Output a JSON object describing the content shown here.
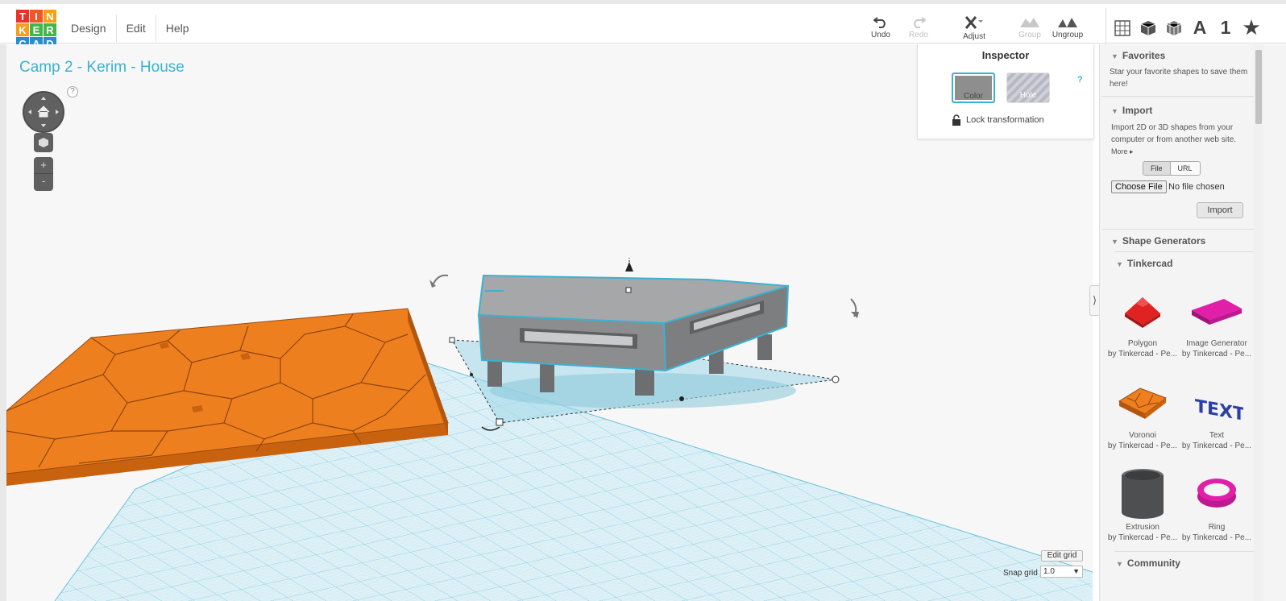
{
  "brand": {
    "logo_letters": [
      "T",
      "I",
      "N",
      "K",
      "E",
      "R",
      "C",
      "A",
      "D"
    ],
    "logo_colors": [
      "#e7322d",
      "#e7322d",
      "#f79e1b",
      "#f79e1b",
      "#41b649",
      "#41b649",
      "#41b649",
      "#2b8ad1",
      "#2b8ad1"
    ]
  },
  "menu": {
    "items": [
      "Design",
      "Edit",
      "Help"
    ]
  },
  "toolbar": {
    "undo": "Undo",
    "redo": "Redo",
    "adjust": "Adjust",
    "group": "Group",
    "ungroup": "Ungroup"
  },
  "view_buttons": {
    "text_button": "A",
    "number_button": "1",
    "icons": [
      "grid-view-icon",
      "box-view-icon",
      "wireframe-view-icon",
      "text-icon",
      "number-icon",
      "star-icon"
    ]
  },
  "design": {
    "title": "Camp 2 - Kerim - House"
  },
  "view_controls": {
    "help": "?",
    "zoom_in": "+",
    "zoom_out": "-"
  },
  "inspector": {
    "title": "Inspector",
    "help": "?",
    "color_label": "Color",
    "hole_label": "Hole",
    "lock_label": "Lock transformation",
    "selected_color": "#8e8e8e"
  },
  "workplane": {
    "edit_grid_label": "Edit grid",
    "snap_grid_label": "Snap grid",
    "snap_grid_value": "1.0"
  },
  "sidebar": {
    "favorites": {
      "title": "Favorites",
      "text": "Star your favorite shapes to save them here!"
    },
    "import": {
      "title": "Import",
      "text": "Import 2D or 3D shapes from your computer or from another web site.",
      "more": "More ▸",
      "tab_file": "File",
      "tab_url": "URL",
      "choose_file": "Choose File",
      "no_file": "No file chosen",
      "import_button": "Import"
    },
    "shape_generators": {
      "title": "Shape Generators",
      "subsection": "Tinkercad",
      "shapes": [
        {
          "name": "Polygon",
          "by": "by Tinkercad - Pe..."
        },
        {
          "name": "Image Generator",
          "by": "by Tinkercad - Pe..."
        },
        {
          "name": "Voronoi",
          "by": "by Tinkercad - Pe..."
        },
        {
          "name": "Text",
          "by": "by Tinkercad - Pe..."
        },
        {
          "name": "Extrusion",
          "by": "by Tinkercad - Pe..."
        },
        {
          "name": "Ring",
          "by": "by Tinkercad - Pe..."
        }
      ],
      "community": "Community"
    }
  },
  "colors": {
    "accent": "#3bb2d0",
    "voronoi_orange": "#ee7f1f",
    "house_gray": "#8f9092"
  }
}
